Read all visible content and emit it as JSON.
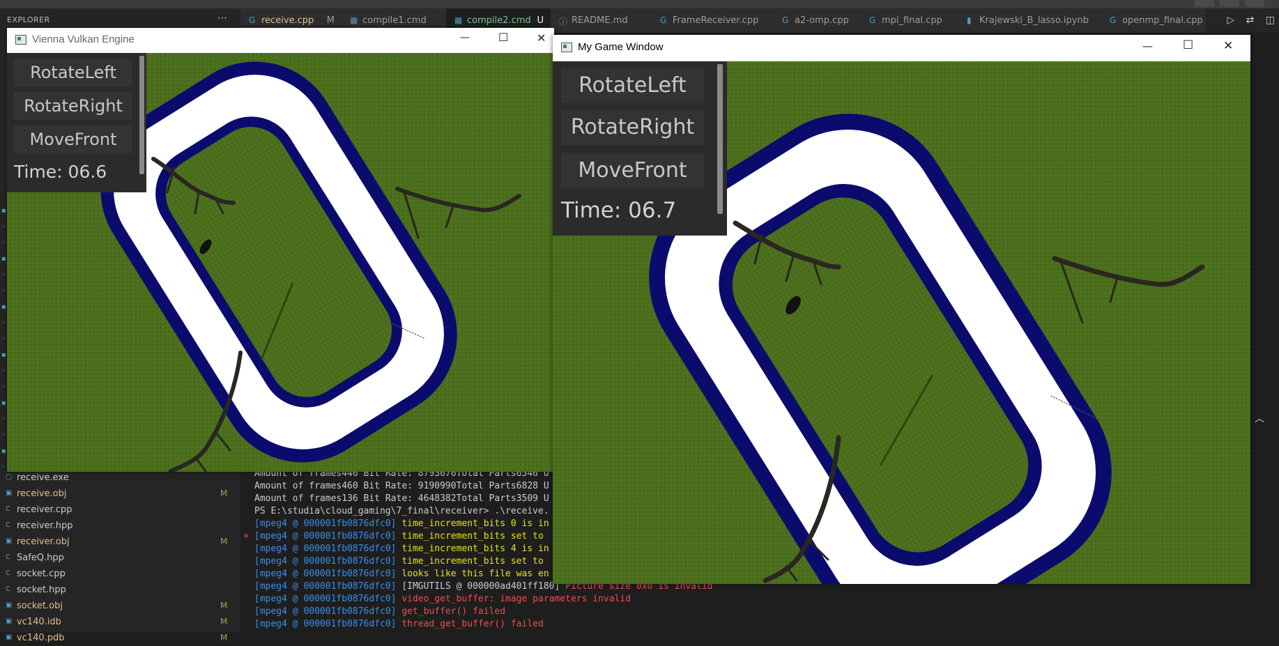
{
  "vscode": {
    "explorer_title": "EXPLORER",
    "more_icon": "ellipsis-icon",
    "files": [
      {
        "name": "receive.exe",
        "badge": "",
        "icon": "file-icon",
        "modified": false
      },
      {
        "name": "receive.obj",
        "badge": "M",
        "icon": "binary-file-icon",
        "modified": true
      },
      {
        "name": "receiver.cpp",
        "badge": "",
        "icon": "cpp-file-icon",
        "modified": false
      },
      {
        "name": "receiver.hpp",
        "badge": "",
        "icon": "hpp-file-icon",
        "modified": false
      },
      {
        "name": "receiver.obj",
        "badge": "M",
        "icon": "binary-file-icon",
        "modified": true
      },
      {
        "name": "SafeQ.hpp",
        "badge": "",
        "icon": "hpp-file-icon",
        "modified": false
      },
      {
        "name": "socket.cpp",
        "badge": "",
        "icon": "cpp-file-icon",
        "modified": false
      },
      {
        "name": "socket.hpp",
        "badge": "",
        "icon": "hpp-file-icon",
        "modified": false
      },
      {
        "name": "socket.obj",
        "badge": "M",
        "icon": "binary-file-icon",
        "modified": true
      },
      {
        "name": "vc140.idb",
        "badge": "M",
        "icon": "binary-file-icon",
        "modified": true
      },
      {
        "name": "vc140.pdb",
        "badge": "M",
        "icon": "binary-file-icon",
        "modified": true
      }
    ],
    "tabs": [
      {
        "label": "receive.cpp",
        "badge": "M",
        "icon": "cpp-file-icon",
        "state": "mod"
      },
      {
        "label": "compile1.cmd",
        "badge": "",
        "icon": "windows-cmd-icon",
        "state": ""
      },
      {
        "label": "compile2.cmd",
        "badge": "U",
        "icon": "windows-cmd-icon",
        "state": "active untracked"
      },
      {
        "label": "README.md",
        "badge": "",
        "icon": "info-icon",
        "state": ""
      },
      {
        "label": "FrameReceiver.cpp",
        "badge": "",
        "icon": "cpp-file-icon",
        "state": ""
      },
      {
        "label": "a2-omp.cpp",
        "badge": "",
        "icon": "cpp-file-icon",
        "state": ""
      },
      {
        "label": "mpi_final.cpp",
        "badge": "",
        "icon": "cpp-file-icon",
        "state": ""
      },
      {
        "label": "Krajewski_B_lasso.ipynb",
        "badge": "",
        "icon": "notebook-icon",
        "state": ""
      },
      {
        "label": "openmp_final.cpp",
        "badge": "",
        "icon": "cpp-file-icon",
        "state": ""
      }
    ],
    "tab_action_icons": [
      "run-icon",
      "compare-icon",
      "split-editor-icon"
    ],
    "terminal_lines": [
      {
        "prefix": "",
        "text": "Amount of frames446 Bit Rate: 8793676Total Parts6546 U",
        "kind": "plain"
      },
      {
        "prefix": "",
        "text": "Amount of frames460 Bit Rate: 9190990Total Parts6828 U",
        "kind": "plain"
      },
      {
        "prefix": "",
        "text": "Amount of frames136 Bit Rate: 4648382Total Parts3509 U",
        "kind": "plain"
      },
      {
        "prefix": "",
        "text": "PS E:\\studia\\cloud_gaming\\7_final\\receiver> .\\receive.",
        "kind": "plain"
      },
      {
        "prefix": "[mpeg4 @ 000001fb0876dfc0]",
        "text": " time_increment_bits 0 is in",
        "kind": "warn"
      },
      {
        "prefix": "[mpeg4 @ 000001fb0876dfc0]",
        "text": " time_increment_bits set to",
        "kind": "warn"
      },
      {
        "prefix": "[mpeg4 @ 000001fb0876dfc0]",
        "text": " time_increment_bits 4 is in",
        "kind": "warn"
      },
      {
        "prefix": "[mpeg4 @ 000001fb0876dfc0]",
        "text": " time_increment_bits set to",
        "kind": "warn"
      },
      {
        "prefix": "[mpeg4 @ 000001fb0876dfc0]",
        "text": " looks like this file was en",
        "kind": "warn"
      },
      {
        "prefix": "[mpeg4 @ 000001fb0876dfc0]",
        "text": " [IMGUTILS @ 000000ad401ff180] Picture size 0x0 is invalid",
        "kind": "mixed"
      },
      {
        "prefix": "[mpeg4 @ 000001fb0876dfc0]",
        "text": " video_get_buffer: image parameters invalid",
        "kind": "err"
      },
      {
        "prefix": "[mpeg4 @ 000001fb0876dfc0]",
        "text": " get_buffer() failed",
        "kind": "err"
      },
      {
        "prefix": "[mpeg4 @ 000001fb0876dfc0]",
        "text": " thread_get_buffer() failed",
        "kind": "err"
      }
    ],
    "mixed_line": {
      "plain": " [IMGUTILS @ 000000ad401ff180]",
      "err": " Picture size 0x0 is invalid"
    },
    "colors": {
      "editor_bg": "#1e1e1e",
      "sidebar_bg": "#252526",
      "warn": "#e5e510",
      "error": "#f14c4c",
      "prefix": "#3b8eea"
    }
  },
  "windows": {
    "left": {
      "title": "Vienna Vulkan Engine",
      "buttons": {
        "rotate_left": "RotateLeft",
        "rotate_right": "RotateRight",
        "move_front": "MoveFront"
      },
      "time_label": "Time: 06.6",
      "icons": [
        "minimize-icon",
        "maximize-icon",
        "close-icon"
      ]
    },
    "right": {
      "title": "My Game Window",
      "buttons": {
        "rotate_left": "RotateLeft",
        "rotate_right": "RotateRight",
        "move_front": "MoveFront"
      },
      "time_label": "Time: 06.7",
      "icons": [
        "minimize-icon",
        "maximize-icon",
        "close-icon"
      ]
    },
    "window_controls": {
      "minimize": "—",
      "maximize": "☐",
      "close": "✕"
    },
    "scene_colors": {
      "grass": "#4a6e1c",
      "track_border": "#0b0b6e",
      "track": "#ffffff",
      "tree": "#2a2620"
    }
  }
}
